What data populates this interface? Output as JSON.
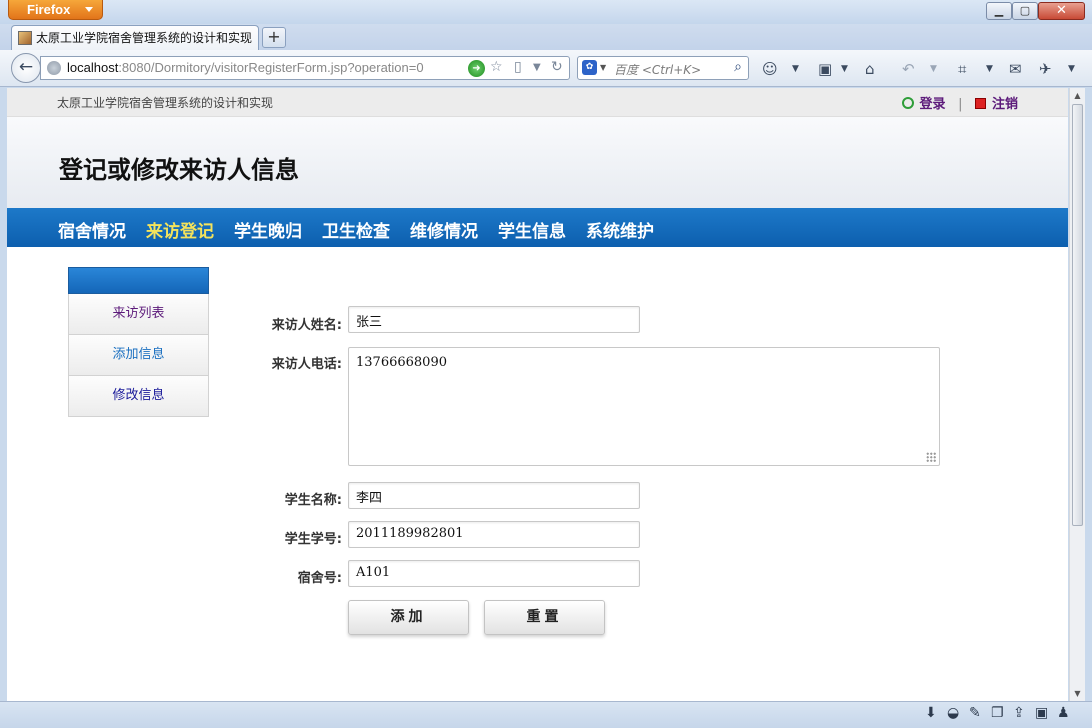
{
  "browser": {
    "app_button": "Firefox",
    "tab_title": "太原工业学院宿舍管理系统的设计和实现",
    "url_host": "localhost",
    "url_rest": ":8080/Dormitory/visitorRegisterForm.jsp?operation=0",
    "search_placeholder": "百度 <Ctrl+K>"
  },
  "site": {
    "name": "太原工业学院宿舍管理系统的设计和实现",
    "login_label": "登录",
    "logout_label": "注销",
    "separator": "|",
    "page_title": "登记或修改来访人信息"
  },
  "nav": {
    "items": [
      "宿舍情况",
      "来访登记",
      "学生晚归",
      "卫生检查",
      "维修情况",
      "学生信息",
      "系统维护"
    ],
    "active_index": 1
  },
  "sidebar": {
    "links": [
      "来访列表",
      "添加信息",
      "修改信息"
    ]
  },
  "form": {
    "visitor_name_label": "来访人姓名:",
    "visitor_name_value": "张三",
    "visitor_phone_label": "来访人电话:",
    "visitor_phone_value": "13766668090",
    "student_name_label": "学生名称:",
    "student_name_value": "李四",
    "student_id_label": "学生学号:",
    "student_id_value": "2011189982801",
    "dorm_label": "宿舍号:",
    "dorm_value": "A101",
    "submit_label": "添加",
    "reset_label": "重置"
  },
  "colors": {
    "nav_bg": "#0d5fae",
    "nav_active": "#f4e35c",
    "login_icon": "#2f9e39",
    "logout_icon": "#dd2222"
  }
}
